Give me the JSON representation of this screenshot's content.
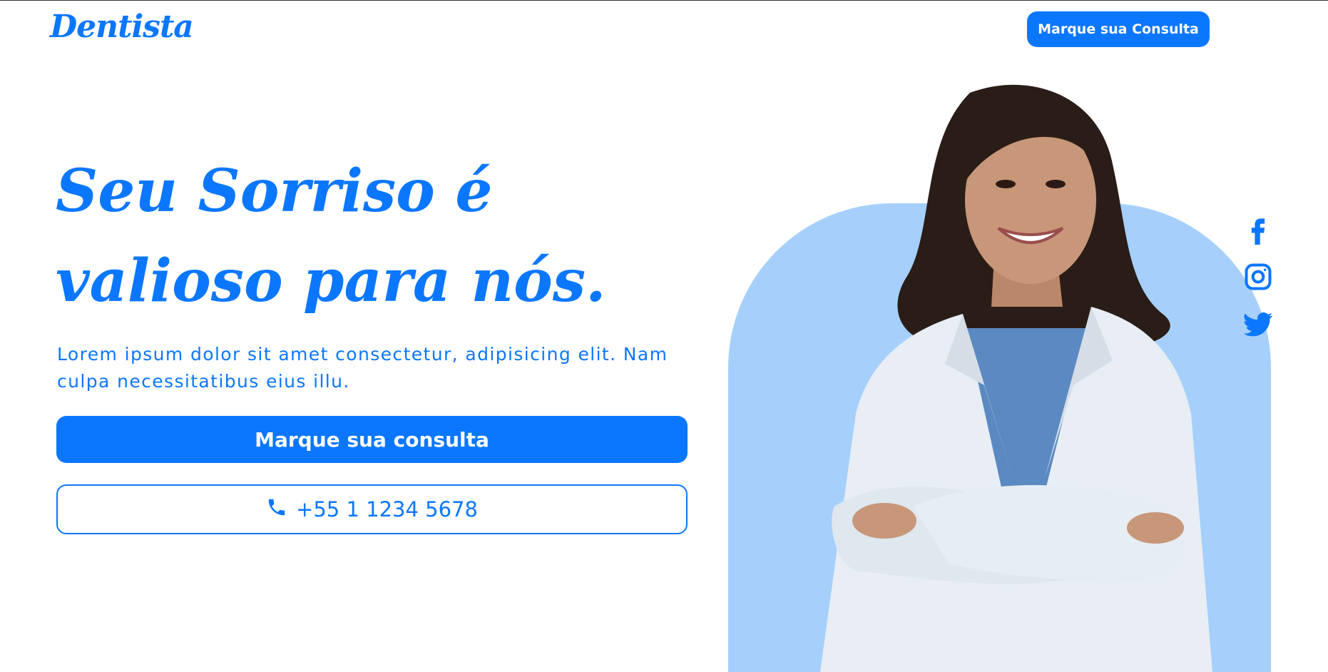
{
  "header": {
    "logo": "Dentista",
    "cta_label": "Marque sua Consulta"
  },
  "hero": {
    "title": "Seu Sorriso é valioso para nós.",
    "description": "Lorem ipsum dolor sit amet consectetur, adipisicing elit. Nam culpa necessitatibus eius illu.",
    "primary_button": "Marque sua consulta",
    "phone": "+55 1 1234 5678"
  },
  "social": {
    "icons": [
      "facebook-icon",
      "instagram-icon",
      "twitter-icon"
    ]
  },
  "colors": {
    "brand": "#0b77ff",
    "arch": "#a6d0fb",
    "background": "#ffffff"
  }
}
